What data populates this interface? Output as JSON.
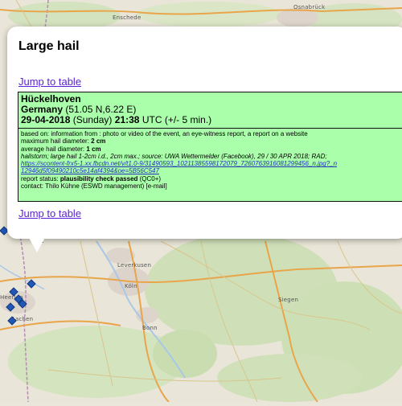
{
  "map": {
    "places": [
      "Enschede",
      "Osnabrück",
      "Leverkusen",
      "Köln",
      "Bonn",
      "Siegen",
      "Aachen",
      "Heerlen"
    ]
  },
  "popup": {
    "title": "Large hail",
    "jump_link_label": "Jump to table",
    "report": {
      "location": "Hückelhoven",
      "country": "Germany",
      "coords": "(51.05 N,6.22 E)",
      "date": "29-04-2018",
      "weekday": "(Sunday)",
      "time": "21:38",
      "time_suffix": "UTC (+/- 5 min.)",
      "based_on": "based on: information from : photo or video of the event, an eye-witness report, a report on a website",
      "max_label": "maximum hail diameter: ",
      "max_value": "2 cm",
      "avg_label": "average hail diameter: ",
      "avg_value": "1 cm",
      "description": "hailstorm; large hail 1-2cm i.d., 2cm max.; source: UWA Wettermelder (Facebook), 29 / 30 APR 2018; RAD;",
      "url_line1": "https://scontent-frx5-1.xx.fbcdn.net/v/t1.0-9/31490593_10211385598172079_7260763916081299456_n.jpg?_n",
      "url_line2": "12946d5f09490210c5e14af4394&oe=5B56C547",
      "status_label": "report status: ",
      "status_value": "plausibility check passed",
      "status_code": "(QC0+)",
      "contact": "contact: Thilo Kühne (ESWD management) [e-mail]"
    }
  }
}
